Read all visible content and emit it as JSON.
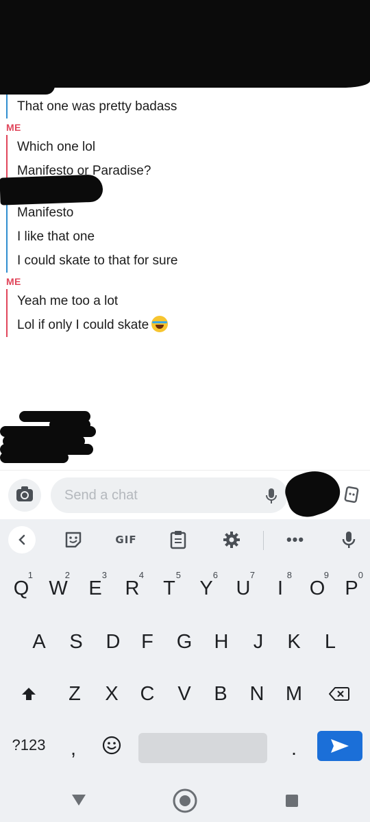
{
  "messages": {
    "group1": [
      "That one was pretty badass"
    ],
    "me_label_1": "ME",
    "group2": [
      "Which one lol",
      "Manifesto or Paradise?"
    ],
    "group3": [
      "Manifesto",
      "I like that one",
      "I could skate to that for sure"
    ],
    "me_label_2": "ME",
    "group4": [
      "Yeah me too a lot",
      "Lol if only I could skate"
    ]
  },
  "composer": {
    "placeholder": "Send a chat"
  },
  "keyboard": {
    "toolbar": {
      "gif_label": "GIF",
      "more_label": "•••"
    },
    "row1": [
      {
        "letter": "Q",
        "num": "1"
      },
      {
        "letter": "W",
        "num": "2"
      },
      {
        "letter": "E",
        "num": "3"
      },
      {
        "letter": "R",
        "num": "4"
      },
      {
        "letter": "T",
        "num": "5"
      },
      {
        "letter": "Y",
        "num": "6"
      },
      {
        "letter": "U",
        "num": "7"
      },
      {
        "letter": "I",
        "num": "8"
      },
      {
        "letter": "O",
        "num": "9"
      },
      {
        "letter": "P",
        "num": "0"
      }
    ],
    "row2": [
      "A",
      "S",
      "D",
      "F",
      "G",
      "H",
      "J",
      "K",
      "L"
    ],
    "row3": [
      "Z",
      "X",
      "C",
      "V",
      "B",
      "N",
      "M"
    ],
    "symbols_label": "?123",
    "comma": ",",
    "period": "."
  },
  "colors": {
    "accent_me": "#e0455a",
    "accent_them": "#2f8ecf",
    "enter_key": "#1b6fd8"
  }
}
